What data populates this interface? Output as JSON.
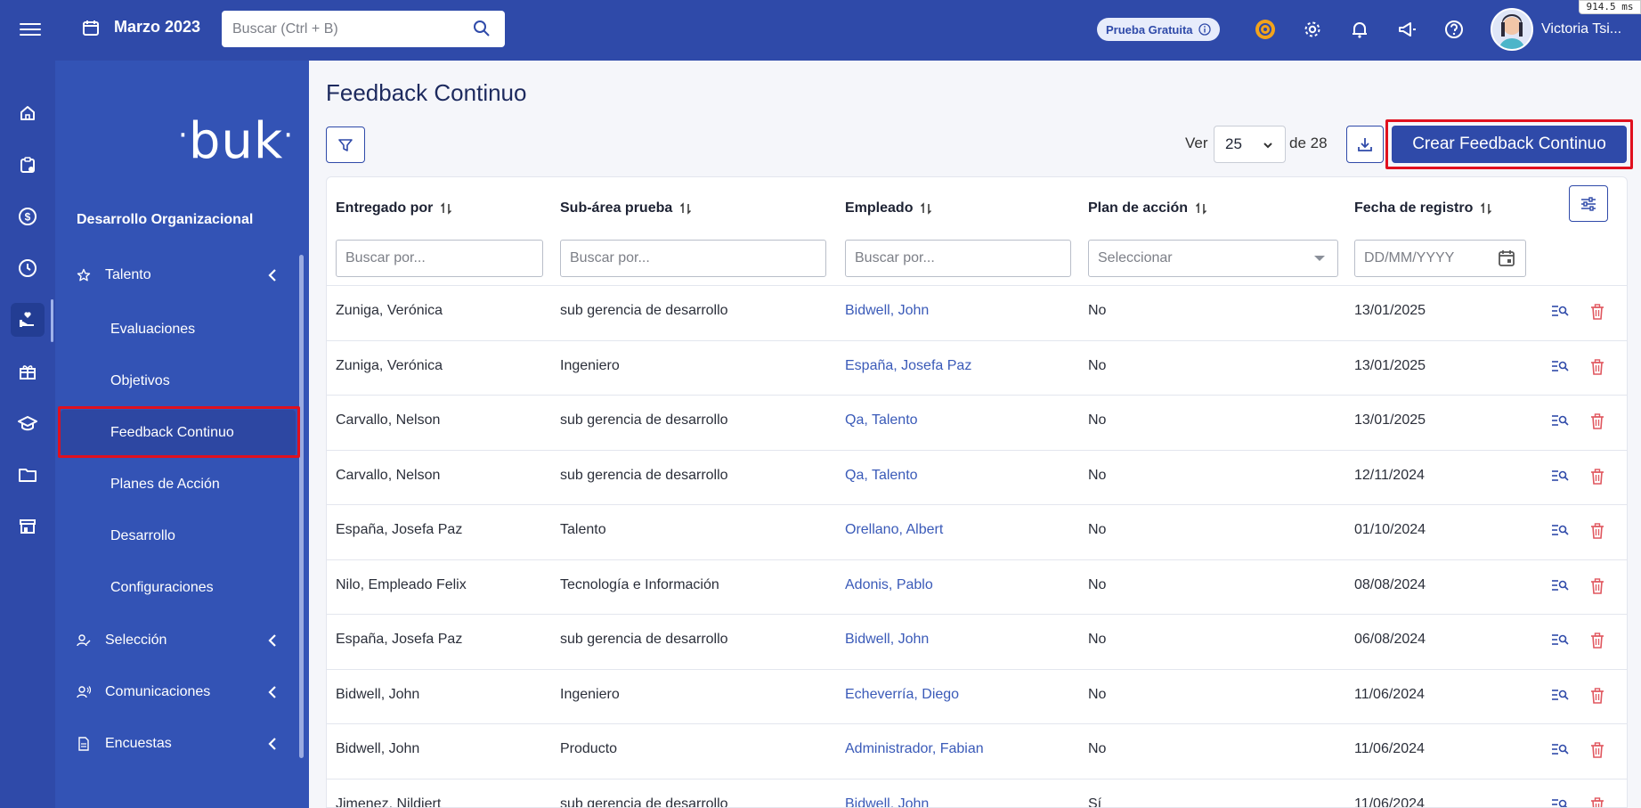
{
  "topbar": {
    "date": "Marzo 2023",
    "search_placeholder": "Buscar (Ctrl + B)",
    "trial_label": "Prueba Gratuita",
    "user_name": "Victoria Tsi...",
    "perf_badge": "914.5 ms"
  },
  "sidebar": {
    "logo_text": "buk",
    "section_title": "Desarrollo Organizacional",
    "talento_label": "Talento",
    "children": [
      "Evaluaciones",
      "Objetivos",
      "Feedback Continuo",
      "Planes de Acción",
      "Desarrollo",
      "Configuraciones"
    ],
    "seleccion_label": "Selección",
    "comunicaciones_label": "Comunicaciones",
    "encuestas_label": "Encuestas",
    "active_item": "Feedback Continuo"
  },
  "page": {
    "title": "Feedback Continuo",
    "ver_label": "Ver",
    "per_page": "25",
    "de_label": "de 28",
    "create_button": "Crear Feedback Continuo"
  },
  "table": {
    "headers": [
      "Entregado por",
      "Sub-área prueba",
      "Empleado",
      "Plan de acción",
      "Fecha de registro"
    ],
    "filter_placeholder": "Buscar por...",
    "select_placeholder": "Seleccionar",
    "date_placeholder": "DD/MM/YYYY",
    "rows": [
      {
        "entregado": "Zuniga, Verónica",
        "subarea": "sub gerencia de desarrollo",
        "empleado": "Bidwell, John",
        "plan": "No",
        "fecha": "13/01/2025"
      },
      {
        "entregado": "Zuniga, Verónica",
        "subarea": "Ingeniero",
        "empleado": "España, Josefa Paz",
        "plan": "No",
        "fecha": "13/01/2025"
      },
      {
        "entregado": "Carvallo, Nelson",
        "subarea": "sub gerencia de desarrollo",
        "empleado": "Qa, Talento",
        "plan": "No",
        "fecha": "13/01/2025"
      },
      {
        "entregado": "Carvallo, Nelson",
        "subarea": "sub gerencia de desarrollo",
        "empleado": "Qa, Talento",
        "plan": "No",
        "fecha": "12/11/2024"
      },
      {
        "entregado": "España, Josefa Paz",
        "subarea": "Talento",
        "empleado": "Orellano, Albert",
        "plan": "No",
        "fecha": "01/10/2024"
      },
      {
        "entregado": "Nilo, Empleado Felix",
        "subarea": "Tecnología e Información",
        "empleado": "Adonis, Pablo",
        "plan": "No",
        "fecha": "08/08/2024"
      },
      {
        "entregado": "España, Josefa Paz",
        "subarea": "sub gerencia de desarrollo",
        "empleado": "Bidwell, John",
        "plan": "No",
        "fecha": "06/08/2024"
      },
      {
        "entregado": "Bidwell, John",
        "subarea": "Ingeniero",
        "empleado": "Echeverría, Diego",
        "plan": "No",
        "fecha": "11/06/2024"
      },
      {
        "entregado": "Bidwell, John",
        "subarea": "Producto",
        "empleado": "Administrador, Fabian",
        "plan": "No",
        "fecha": "11/06/2024"
      },
      {
        "entregado": "Jimenez, Nildiert",
        "subarea": "sub gerencia de desarrollo",
        "empleado": "Bidwell, John",
        "plan": "Sí",
        "fecha": "11/06/2024"
      }
    ]
  },
  "colors": {
    "primary": "#2f4aa9",
    "sidebar": "#3353b5",
    "link": "#3a5ab8",
    "delete": "#e0565e",
    "highlight": "#e0101e"
  }
}
